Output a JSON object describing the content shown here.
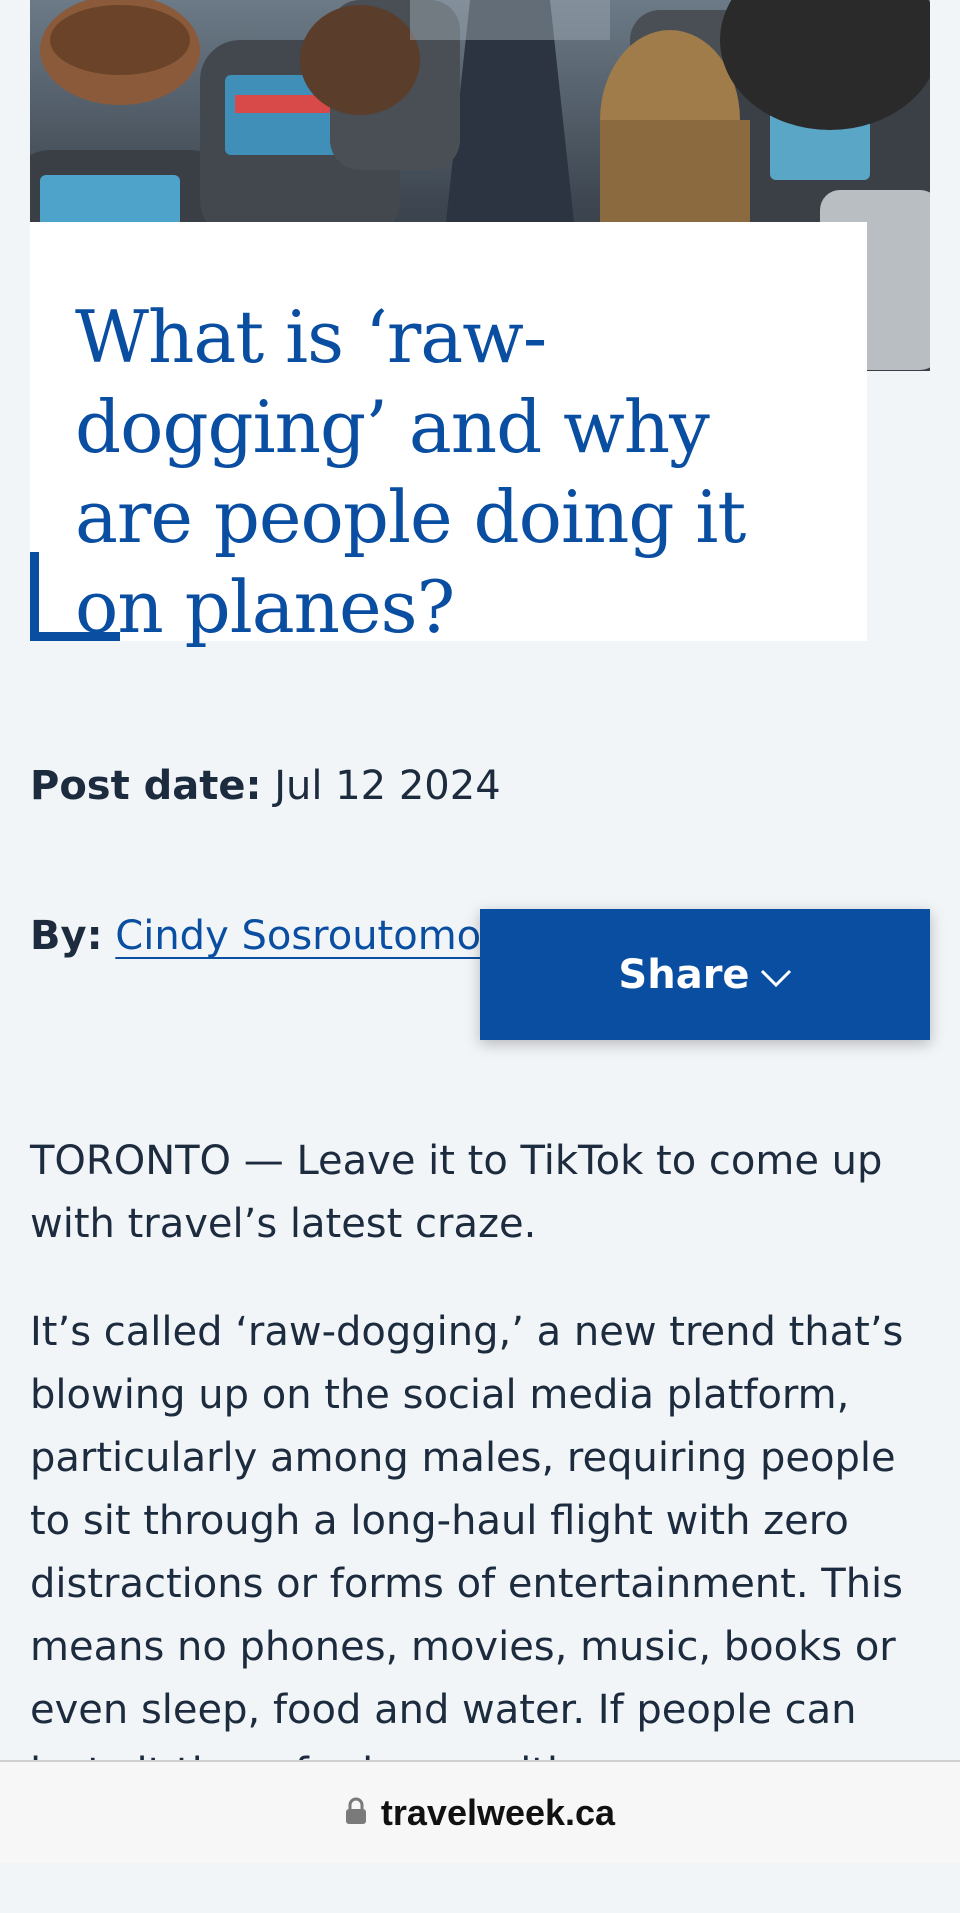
{
  "article": {
    "hero_image_alt": "Passengers seated in an airplane cabin aisle with seatback screens",
    "title": "What is ‘raw-dogging’ and why are people doing it on planes?",
    "post_date_label": "Post date:",
    "post_date": "Jul 12 2024",
    "by_label": "By:",
    "author": "Cindy Sosroutomo",
    "share_label": "Share",
    "paragraphs": [
      "TORONTO — Leave it to TikTok to come up with travel’s latest craze.",
      "It’s called ‘raw-dogging,’ a new trend that’s blowing up on the social media platform, particularly among males, requiring people to sit through a long-haul flight with zero distractions or forms of entertainment. This means no phones, movies, music, books or even sleep, food and water. If people can just sit there for hours with no entertainment"
    ]
  },
  "browser": {
    "domain": "travelweek.ca",
    "lock_icon": "lock-icon"
  },
  "colors": {
    "accent": "#0a4ea2",
    "page_bg": "#f2f5f8",
    "text": "#1c2b3e"
  }
}
